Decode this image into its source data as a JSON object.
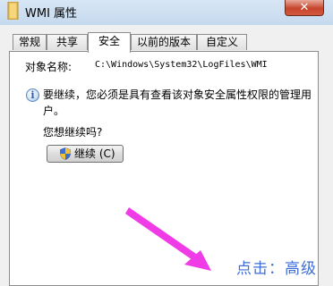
{
  "window": {
    "title": "WMI 属性",
    "close_symbol": "✕"
  },
  "tabs": [
    {
      "label": "常规",
      "active": false
    },
    {
      "label": "共享",
      "active": false
    },
    {
      "label": "安全",
      "active": true
    },
    {
      "label": "以前的版本",
      "active": false
    },
    {
      "label": "自定义",
      "active": false
    }
  ],
  "security": {
    "object_name_label": "对象名称:",
    "object_name_value": "C:\\Windows\\System32\\LogFiles\\WMI",
    "info_icon": "information-icon",
    "info_text": "要继续，您必须是具有查看该对象安全属性权限的管理用户。",
    "question": "您想继续吗?",
    "continue_button_label": "继续 (C)",
    "continue_button_icon": "uac-shield-icon"
  },
  "annotation": {
    "text": "点击：高级",
    "color": "#3d6fd6",
    "arrow_color": "#f03ce6"
  }
}
